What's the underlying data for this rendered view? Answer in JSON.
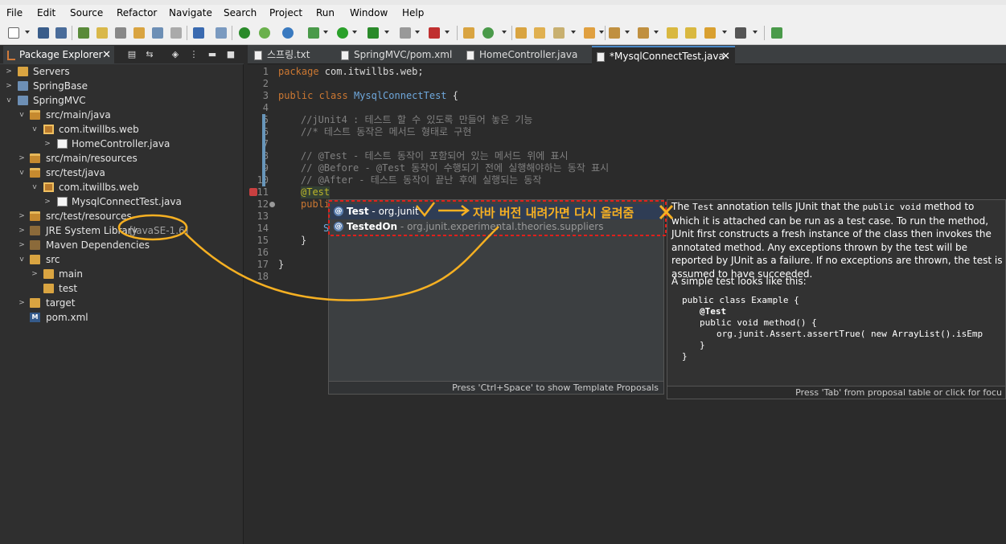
{
  "menu": [
    "File",
    "Edit",
    "Source",
    "Refactor",
    "Navigate",
    "Search",
    "Project",
    "Run",
    "Window",
    "Help"
  ],
  "package_explorer": {
    "title": "Package Explorer",
    "tree": [
      {
        "label": "Servers",
        "icon": "folder-icon"
      },
      {
        "label": "SpringBase",
        "icon": "project-icon"
      },
      {
        "label": "SpringMVC",
        "icon": "project-icon"
      },
      {
        "label": "src/main/java",
        "icon": "source-folder-icon"
      },
      {
        "label": "com.itwillbs.web",
        "icon": "package-icon"
      },
      {
        "label": "HomeController.java",
        "icon": "java-file-icon"
      },
      {
        "label": "src/main/resources",
        "icon": "source-folder-icon"
      },
      {
        "label": "src/test/java",
        "icon": "source-folder-icon"
      },
      {
        "label": "com.itwillbs.web",
        "icon": "package-icon"
      },
      {
        "label": "MysqlConnectTest.java",
        "icon": "java-file-icon"
      },
      {
        "label": "src/test/resources",
        "icon": "source-folder-icon"
      },
      {
        "label": "JRE System Library",
        "suffix": "[JavaSE-1.6]",
        "icon": "library-icon"
      },
      {
        "label": "Maven Dependencies",
        "icon": "library-icon"
      },
      {
        "label": "src",
        "icon": "folder-icon"
      },
      {
        "label": "main",
        "icon": "folder-icon"
      },
      {
        "label": "test",
        "icon": "folder-icon"
      },
      {
        "label": "target",
        "icon": "folder-icon"
      },
      {
        "label": "pom.xml",
        "icon": "xml-file-icon"
      }
    ]
  },
  "editor_tabs": [
    {
      "label": "스프링.txt"
    },
    {
      "label": "SpringMVC/pom.xml"
    },
    {
      "label": "HomeController.java"
    },
    {
      "label": "*MysqlConnectTest.java",
      "active": true
    }
  ],
  "code": {
    "line_numbers": [
      "1",
      "2",
      "3",
      "4",
      "5",
      "6",
      "7",
      "8",
      "9",
      "10",
      "11",
      "12",
      "13",
      "14",
      "15",
      "16",
      "17",
      "18"
    ],
    "l1_kw": "package",
    "l1_rest": " com.itwillbs.web;",
    "l3_kw": "public class",
    "l3_cls": "MysqlConnectTest",
    "l3_rest": " {",
    "l5": "//jUnit4 : 테스트 할 수 있도록 만들어 놓은 기능",
    "l6": "//* 테스트 동작은 메서드 형태로 구현",
    "l8": "// @Test - 테스트 동작이 포함되어 있는 메서드 위에 표시",
    "l9": "// @Before - @Test 동작이 수행되기 전에 실행해야하는 동작 표시",
    "l10": "// @After - 테스트 동작이 끝난 후에 실행되는 동작",
    "l11": "@Test",
    "l12": "publi",
    "l14": "S",
    "l15": "}",
    "l17": "}"
  },
  "proposals": {
    "items": [
      {
        "name": "Test",
        "sep": " - ",
        "pkg": "org.junit"
      },
      {
        "name": "TestedOn",
        "sep": " - ",
        "pkg": "org.junit.experimental.theories.suppliers"
      }
    ],
    "status": "Press 'Ctrl+Space' to show Template Proposals"
  },
  "doc": {
    "p1a": "The ",
    "p1code": "Test",
    "p1b": " annotation tells JUnit that the ",
    "p1code2": "public void",
    "p1c": " method to which it is attached can be run as a test case. To run the method, JUnit first constructs a fresh instance of the class then invokes the annotated method. Any exceptions thrown by the test will be reported by JUnit as a failure. If no exceptions are thrown, the test is assumed to have succeeded.",
    "p2": "A simple test looks like this:",
    "code1": "public class Example {",
    "code2": "@Test",
    "code3": "public void method() {",
    "code4": "org.junit.Assert.assertTrue( new ArrayList().isEmp",
    "code5": "}",
    "code6": "}",
    "status": "Press 'Tab' from proposal table or click for focu"
  },
  "annotation_note": "자바 버전 내려가면 다시 올려줌",
  "colors": {
    "annotation": "#f6b022",
    "dashed_box": "#e0201b"
  }
}
